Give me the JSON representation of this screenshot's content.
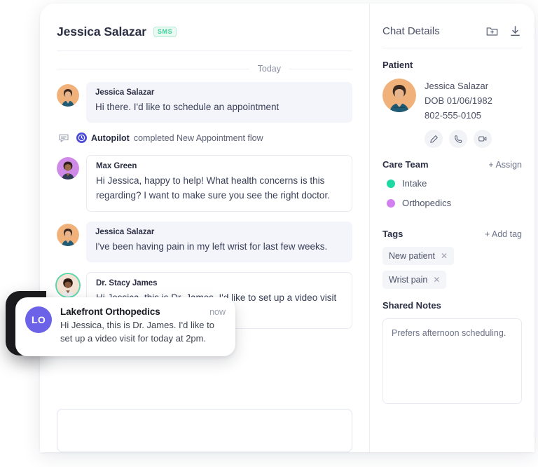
{
  "conversation": {
    "title": "Jessica Salazar",
    "channel_badge": "SMS",
    "day_separator": "Today",
    "messages": [
      {
        "type": "message",
        "direction": "inbound",
        "author": "Jessica Salazar",
        "text": "Hi there. I'd like to schedule an appointment"
      },
      {
        "type": "system",
        "icon": "chat-bubble-icon",
        "actor": "Autopilot",
        "text": "completed New Appointment flow"
      },
      {
        "type": "message",
        "direction": "outbound",
        "author": "Max Green",
        "text": "Hi Jessica, happy to help! What health concerns is this regarding? I want to make sure you see the right doctor."
      },
      {
        "type": "message",
        "direction": "inbound",
        "author": "Jessica Salazar",
        "text": "I've been having pain in my left wrist for last few weeks."
      },
      {
        "type": "message",
        "direction": "outbound",
        "author": "Dr. Stacy James",
        "text": "Hi Jessica, this is Dr. James. I'd like to set up a video visit for today at 2pm."
      }
    ],
    "composer_placeholder": ""
  },
  "details": {
    "title": "Chat Details",
    "header_actions": [
      {
        "name": "add-to-folder-icon",
        "label": "Add to folder"
      },
      {
        "name": "download-icon",
        "label": "Download transcript"
      }
    ],
    "patient": {
      "section_title": "Patient",
      "name": "Jessica Salazar",
      "dob": "DOB 01/06/1982",
      "phone": "802-555-0105",
      "actions": [
        {
          "name": "edit-icon",
          "label": "Edit"
        },
        {
          "name": "phone-icon",
          "label": "Call"
        },
        {
          "name": "video-icon",
          "label": "Video"
        }
      ]
    },
    "care_team": {
      "section_title": "Care Team",
      "action": "+ Assign",
      "members": [
        {
          "label": "Intake",
          "color": "#1ed9a4"
        },
        {
          "label": "Orthopedics",
          "color": "#d27ff0"
        }
      ]
    },
    "tags": {
      "section_title": "Tags",
      "action": "+ Add tag",
      "items": [
        "New patient",
        "Wrist pain"
      ]
    },
    "shared_notes": {
      "section_title": "Shared Notes",
      "value": "Prefers afternoon scheduling."
    }
  },
  "notification": {
    "avatar_initials": "LO",
    "title": "Lakefront Orthopedics",
    "time": "now",
    "text": "Hi Jessica, this is Dr. James. I'd like to set up a video visit for today at 2pm."
  }
}
